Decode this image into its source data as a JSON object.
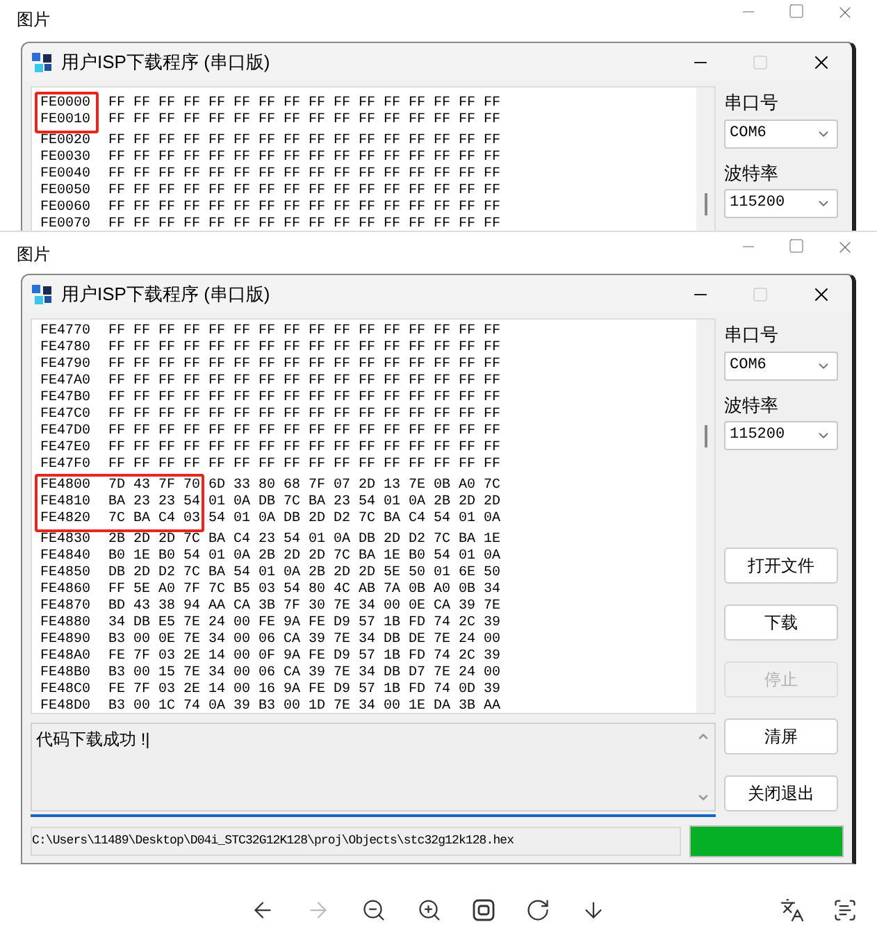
{
  "viewers": [
    {
      "title": "图片",
      "app": {
        "title": "用户ISP下载程序 (串口版)",
        "rows": [
          {
            "address": "FE0000",
            "bytes": "FF FF FF FF FF FF FF FF FF FF FF FF FF FF FF FF"
          },
          {
            "address": "FE0010",
            "bytes": "FF FF FF FF FF FF FF FF FF FF FF FF FF FF FF FF"
          },
          {
            "address": "FE0020",
            "bytes": "FF FF FF FF FF FF FF FF FF FF FF FF FF FF FF FF"
          },
          {
            "address": "FE0030",
            "bytes": "FF FF FF FF FF FF FF FF FF FF FF FF FF FF FF FF"
          },
          {
            "address": "FE0040",
            "bytes": "FF FF FF FF FF FF FF FF FF FF FF FF FF FF FF FF"
          },
          {
            "address": "FE0050",
            "bytes": "FF FF FF FF FF FF FF FF FF FF FF FF FF FF FF FF"
          },
          {
            "address": "FE0060",
            "bytes": "FF FF FF FF FF FF FF FF FF FF FF FF FF FF FF FF"
          },
          {
            "address": "FE0070",
            "bytes": "FF FF FF FF FF FF FF FF FF FF FF FF FF FF FF FF"
          }
        ],
        "port_label": "串口号",
        "port": "COM6",
        "baud_label": "波特率",
        "baud": "115200"
      }
    },
    {
      "title": "图片",
      "app": {
        "title": "用户ISP下载程序 (串口版)",
        "rows": [
          {
            "address": "FE4770",
            "bytes": "FF FF FF FF FF FF FF FF FF FF FF FF FF FF FF FF"
          },
          {
            "address": "FE4780",
            "bytes": "FF FF FF FF FF FF FF FF FF FF FF FF FF FF FF FF"
          },
          {
            "address": "FE4790",
            "bytes": "FF FF FF FF FF FF FF FF FF FF FF FF FF FF FF FF"
          },
          {
            "address": "FE47A0",
            "bytes": "FF FF FF FF FF FF FF FF FF FF FF FF FF FF FF FF"
          },
          {
            "address": "FE47B0",
            "bytes": "FF FF FF FF FF FF FF FF FF FF FF FF FF FF FF FF"
          },
          {
            "address": "FE47C0",
            "bytes": "FF FF FF FF FF FF FF FF FF FF FF FF FF FF FF FF"
          },
          {
            "address": "FE47D0",
            "bytes": "FF FF FF FF FF FF FF FF FF FF FF FF FF FF FF FF"
          },
          {
            "address": "FE47E0",
            "bytes": "FF FF FF FF FF FF FF FF FF FF FF FF FF FF FF FF"
          },
          {
            "address": "FE47F0",
            "bytes": "FF FF FF FF FF FF FF FF FF FF FF FF FF FF FF FF"
          },
          {
            "address": "FE4800",
            "bytes": "7D 43 7F 70 6D 33 80 68 7F 07 2D 13 7E 0B A0 7C"
          },
          {
            "address": "FE4810",
            "bytes": "BA 23 23 54 01 0A DB 7C BA 23 54 01 0A 2B 2D 2D"
          },
          {
            "address": "FE4820",
            "bytes": "7C BA C4 03 54 01 0A DB 2D D2 7C BA C4 54 01 0A"
          },
          {
            "address": "FE4830",
            "bytes": "2B 2D 2D 7C BA C4 23 54 01 0A DB 2D D2 7C BA 1E"
          },
          {
            "address": "FE4840",
            "bytes": "B0 1E B0 54 01 0A 2B 2D 2D 7C BA 1E B0 54 01 0A"
          },
          {
            "address": "FE4850",
            "bytes": "DB 2D D2 7C BA 54 01 0A 2B 2D 2D 5E 50 01 6E 50"
          },
          {
            "address": "FE4860",
            "bytes": "FF 5E A0 7F 7C B5 03 54 80 4C AB 7A 0B A0 0B 34"
          },
          {
            "address": "FE4870",
            "bytes": "BD 43 38 94 AA CA 3B 7F 30 7E 34 00 0E CA 39 7E"
          },
          {
            "address": "FE4880",
            "bytes": "34 DB E5 7E 24 00 FE 9A FE D9 57 1B FD 74 2C 39"
          },
          {
            "address": "FE4890",
            "bytes": "B3 00 0E 7E 34 00 06 CA 39 7E 34 DB DE 7E 24 00"
          },
          {
            "address": "FE48A0",
            "bytes": "FE 7F 03 2E 14 00 0F 9A FE D9 57 1B FD 74 2C 39"
          },
          {
            "address": "FE48B0",
            "bytes": "B3 00 15 7E 34 00 06 CA 39 7E 34 DB D7 7E 24 00"
          },
          {
            "address": "FE48C0",
            "bytes": "FE 7F 03 2E 14 00 16 9A FE D9 57 1B FD 74 0D 39"
          },
          {
            "address": "FE48D0",
            "bytes": "B3 00 1C 74 0A 39 B3 00 1D 7E 34 00 1E DA 3B AA"
          }
        ],
        "port_label": "串口号",
        "port": "COM6",
        "baud_label": "波特率",
        "baud": "115200",
        "buttons": [
          {
            "label": "打开文件",
            "disabled": false
          },
          {
            "label": "下载",
            "disabled": false
          },
          {
            "label": "停止",
            "disabled": true
          },
          {
            "label": "清屏",
            "disabled": false
          },
          {
            "label": "关闭退出",
            "disabled": false
          }
        ],
        "log": "代码下载成功 !|",
        "path": "C:\\Users\\11489\\Desktop\\D04i_STC32G12K128\\proj\\Objects\\stc32g12k128.hex",
        "progress": {
          "level": 1
        }
      }
    }
  ]
}
